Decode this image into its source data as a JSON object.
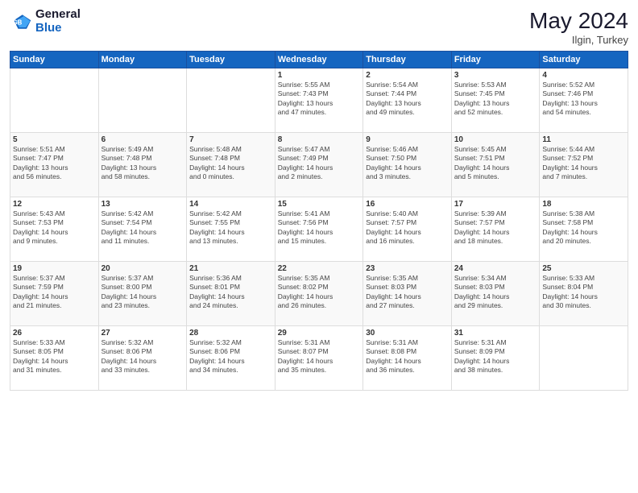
{
  "header": {
    "logo_line1": "General",
    "logo_line2": "Blue",
    "month_year": "May 2024",
    "location": "Ilgin, Turkey"
  },
  "days_of_week": [
    "Sunday",
    "Monday",
    "Tuesday",
    "Wednesday",
    "Thursday",
    "Friday",
    "Saturday"
  ],
  "weeks": [
    [
      {
        "day": "",
        "info": ""
      },
      {
        "day": "",
        "info": ""
      },
      {
        "day": "",
        "info": ""
      },
      {
        "day": "1",
        "info": "Sunrise: 5:55 AM\nSunset: 7:43 PM\nDaylight: 13 hours\nand 47 minutes."
      },
      {
        "day": "2",
        "info": "Sunrise: 5:54 AM\nSunset: 7:44 PM\nDaylight: 13 hours\nand 49 minutes."
      },
      {
        "day": "3",
        "info": "Sunrise: 5:53 AM\nSunset: 7:45 PM\nDaylight: 13 hours\nand 52 minutes."
      },
      {
        "day": "4",
        "info": "Sunrise: 5:52 AM\nSunset: 7:46 PM\nDaylight: 13 hours\nand 54 minutes."
      }
    ],
    [
      {
        "day": "5",
        "info": "Sunrise: 5:51 AM\nSunset: 7:47 PM\nDaylight: 13 hours\nand 56 minutes."
      },
      {
        "day": "6",
        "info": "Sunrise: 5:49 AM\nSunset: 7:48 PM\nDaylight: 13 hours\nand 58 minutes."
      },
      {
        "day": "7",
        "info": "Sunrise: 5:48 AM\nSunset: 7:48 PM\nDaylight: 14 hours\nand 0 minutes."
      },
      {
        "day": "8",
        "info": "Sunrise: 5:47 AM\nSunset: 7:49 PM\nDaylight: 14 hours\nand 2 minutes."
      },
      {
        "day": "9",
        "info": "Sunrise: 5:46 AM\nSunset: 7:50 PM\nDaylight: 14 hours\nand 3 minutes."
      },
      {
        "day": "10",
        "info": "Sunrise: 5:45 AM\nSunset: 7:51 PM\nDaylight: 14 hours\nand 5 minutes."
      },
      {
        "day": "11",
        "info": "Sunrise: 5:44 AM\nSunset: 7:52 PM\nDaylight: 14 hours\nand 7 minutes."
      }
    ],
    [
      {
        "day": "12",
        "info": "Sunrise: 5:43 AM\nSunset: 7:53 PM\nDaylight: 14 hours\nand 9 minutes."
      },
      {
        "day": "13",
        "info": "Sunrise: 5:42 AM\nSunset: 7:54 PM\nDaylight: 14 hours\nand 11 minutes."
      },
      {
        "day": "14",
        "info": "Sunrise: 5:42 AM\nSunset: 7:55 PM\nDaylight: 14 hours\nand 13 minutes."
      },
      {
        "day": "15",
        "info": "Sunrise: 5:41 AM\nSunset: 7:56 PM\nDaylight: 14 hours\nand 15 minutes."
      },
      {
        "day": "16",
        "info": "Sunrise: 5:40 AM\nSunset: 7:57 PM\nDaylight: 14 hours\nand 16 minutes."
      },
      {
        "day": "17",
        "info": "Sunrise: 5:39 AM\nSunset: 7:57 PM\nDaylight: 14 hours\nand 18 minutes."
      },
      {
        "day": "18",
        "info": "Sunrise: 5:38 AM\nSunset: 7:58 PM\nDaylight: 14 hours\nand 20 minutes."
      }
    ],
    [
      {
        "day": "19",
        "info": "Sunrise: 5:37 AM\nSunset: 7:59 PM\nDaylight: 14 hours\nand 21 minutes."
      },
      {
        "day": "20",
        "info": "Sunrise: 5:37 AM\nSunset: 8:00 PM\nDaylight: 14 hours\nand 23 minutes."
      },
      {
        "day": "21",
        "info": "Sunrise: 5:36 AM\nSunset: 8:01 PM\nDaylight: 14 hours\nand 24 minutes."
      },
      {
        "day": "22",
        "info": "Sunrise: 5:35 AM\nSunset: 8:02 PM\nDaylight: 14 hours\nand 26 minutes."
      },
      {
        "day": "23",
        "info": "Sunrise: 5:35 AM\nSunset: 8:03 PM\nDaylight: 14 hours\nand 27 minutes."
      },
      {
        "day": "24",
        "info": "Sunrise: 5:34 AM\nSunset: 8:03 PM\nDaylight: 14 hours\nand 29 minutes."
      },
      {
        "day": "25",
        "info": "Sunrise: 5:33 AM\nSunset: 8:04 PM\nDaylight: 14 hours\nand 30 minutes."
      }
    ],
    [
      {
        "day": "26",
        "info": "Sunrise: 5:33 AM\nSunset: 8:05 PM\nDaylight: 14 hours\nand 31 minutes."
      },
      {
        "day": "27",
        "info": "Sunrise: 5:32 AM\nSunset: 8:06 PM\nDaylight: 14 hours\nand 33 minutes."
      },
      {
        "day": "28",
        "info": "Sunrise: 5:32 AM\nSunset: 8:06 PM\nDaylight: 14 hours\nand 34 minutes."
      },
      {
        "day": "29",
        "info": "Sunrise: 5:31 AM\nSunset: 8:07 PM\nDaylight: 14 hours\nand 35 minutes."
      },
      {
        "day": "30",
        "info": "Sunrise: 5:31 AM\nSunset: 8:08 PM\nDaylight: 14 hours\nand 36 minutes."
      },
      {
        "day": "31",
        "info": "Sunrise: 5:31 AM\nSunset: 8:09 PM\nDaylight: 14 hours\nand 38 minutes."
      },
      {
        "day": "",
        "info": ""
      }
    ]
  ]
}
